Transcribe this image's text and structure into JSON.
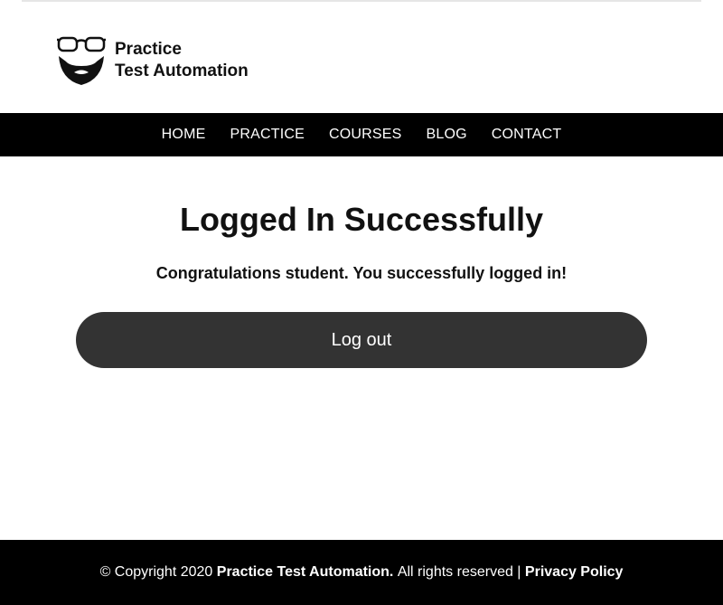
{
  "brand": {
    "line1": "Practice",
    "line2": "Test Automation",
    "logo_icon": "glasses-beard-logo-icon"
  },
  "nav": {
    "items": [
      {
        "label": "HOME"
      },
      {
        "label": "PRACTICE"
      },
      {
        "label": "COURSES"
      },
      {
        "label": "BLOG"
      },
      {
        "label": "CONTACT"
      }
    ]
  },
  "main": {
    "title": "Logged In Successfully",
    "message": "Congratulations student. You successfully logged in!",
    "logout_label": "Log out"
  },
  "footer": {
    "copyright_prefix": "© Copyright 2020",
    "company": "Practice Test Automation.",
    "rights": "All rights reserved |",
    "privacy_label": "Privacy Policy"
  },
  "colors": {
    "nav_bg": "#000000",
    "footer_bg": "#000000",
    "button_bg": "#333333",
    "text": "#111111"
  }
}
